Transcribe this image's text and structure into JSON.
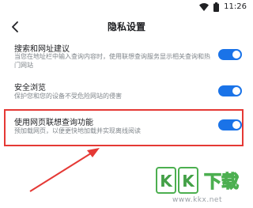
{
  "status_bar": {
    "time": "11:26",
    "icons": [
      "wifi-icon",
      "battery-icon"
    ]
  },
  "header": {
    "title": "隐私设置",
    "back_icon": "back-arrow-icon"
  },
  "settings": [
    {
      "title": "搜索和网址建议",
      "description": "当您在地址栏中输入查询内容时，使用联想查询服务显示相关查询和热门网站",
      "enabled": true
    },
    {
      "title": "安全浏览",
      "description": "保护您和您的设备不受危险网站的侵害",
      "enabled": true
    },
    {
      "title": "使用网页联想查询功能",
      "description": "预加载网页，以便更快地加载并实现离线阅读",
      "enabled": true,
      "highlighted": true
    }
  ],
  "colors": {
    "accent": "#1a73e8",
    "highlight_border": "#e53935",
    "annotation_arrow": "#e53935"
  },
  "watermark": {
    "logo_text": "KK下载",
    "url": "www.kkx.net"
  }
}
